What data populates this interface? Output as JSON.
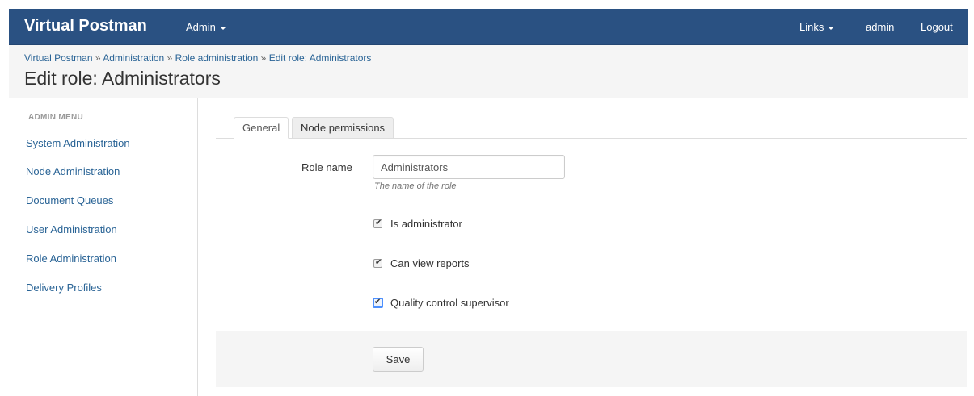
{
  "navbar": {
    "brand": "Virtual Postman",
    "admin_menu_label": "Admin",
    "links_menu_label": "Links",
    "user_label": "admin",
    "logout_label": "Logout",
    "background_color": "#2a5182"
  },
  "breadcrumb": {
    "items": [
      "Virtual Postman",
      "Administration",
      "Role administration",
      "Edit role: Administrators"
    ],
    "separator": "»"
  },
  "page": {
    "title": "Edit role: Administrators"
  },
  "sidebar": {
    "header": "ADMIN MENU",
    "items": [
      {
        "label": "System Administration"
      },
      {
        "label": "Node Administration"
      },
      {
        "label": "Document Queues"
      },
      {
        "label": "User Administration"
      },
      {
        "label": "Role Administration"
      },
      {
        "label": "Delivery Profiles"
      }
    ]
  },
  "tabs": [
    {
      "label": "General",
      "active": true
    },
    {
      "label": "Node permissions",
      "active": false
    }
  ],
  "form": {
    "role_name_label": "Role name",
    "role_name_value": "Administrators",
    "role_name_help": "The name of the role",
    "checkboxes": [
      {
        "label": "Is administrator",
        "checked": true
      },
      {
        "label": "Can view reports",
        "checked": true
      },
      {
        "label": "Quality control supervisor",
        "checked": true
      }
    ],
    "save_label": "Save"
  }
}
